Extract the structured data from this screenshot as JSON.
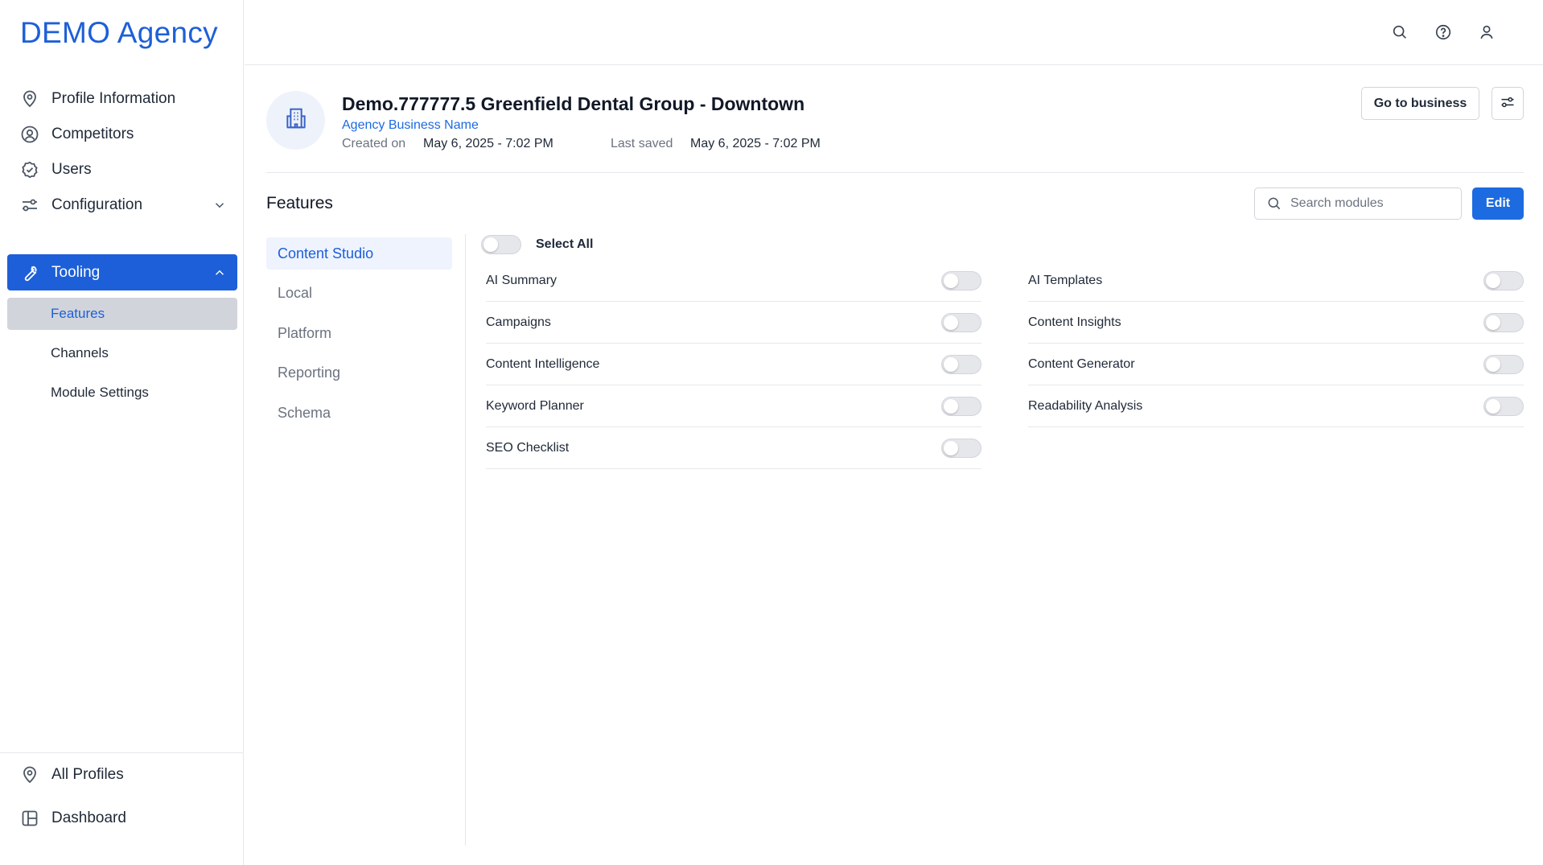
{
  "brand": "DEMO Agency",
  "sidebar": {
    "items": [
      {
        "label": "Profile Information",
        "icon": "map-pin-icon"
      },
      {
        "label": "Competitors",
        "icon": "user-circle-icon"
      },
      {
        "label": "Users",
        "icon": "badge-check-icon"
      },
      {
        "label": "Configuration",
        "icon": "sliders-icon"
      },
      {
        "label": "Tooling",
        "icon": "wrench-icon"
      }
    ],
    "sub_items": [
      {
        "label": "Features"
      },
      {
        "label": "Channels"
      },
      {
        "label": "Module Settings"
      }
    ],
    "bottom_items": [
      {
        "label": "All Profiles",
        "icon": "map-pin-icon"
      },
      {
        "label": "Dashboard",
        "icon": "layout-icon"
      }
    ]
  },
  "topbar": {
    "icons": [
      "search-icon",
      "help-icon",
      "user-icon"
    ]
  },
  "business": {
    "title": "Demo.777777.5 Greenfield Dental Group - Downtown",
    "subtitle_link": "Agency Business Name",
    "created_label": "Created on",
    "created_value": "May 6, 2025 - 7:02 PM",
    "saved_label": "Last saved",
    "saved_value": "May 6, 2025 - 7:02 PM",
    "go_button": "Go to business"
  },
  "features": {
    "title": "Features",
    "search_placeholder": "Search modules",
    "edit_button": "Edit",
    "select_all_label": "Select All",
    "categories": [
      "Content Studio",
      "Local",
      "Platform",
      "Reporting",
      "Schema"
    ],
    "active_category": "Content Studio",
    "column1": [
      {
        "label": "AI Summary",
        "enabled": false
      },
      {
        "label": "Campaigns",
        "enabled": false
      },
      {
        "label": "Content Intelligence",
        "enabled": false
      },
      {
        "label": "Keyword Planner",
        "enabled": false
      },
      {
        "label": "SEO Checklist",
        "enabled": false
      }
    ],
    "column2": [
      {
        "label": "AI Templates",
        "enabled": false
      },
      {
        "label": "Content Insights",
        "enabled": false
      },
      {
        "label": "Content Generator",
        "enabled": false
      },
      {
        "label": "Readability Analysis",
        "enabled": false
      }
    ]
  },
  "colors": {
    "accent": "#1d5fd8",
    "primary_button": "#1d6be0",
    "active_sub": "#d1d5db"
  }
}
